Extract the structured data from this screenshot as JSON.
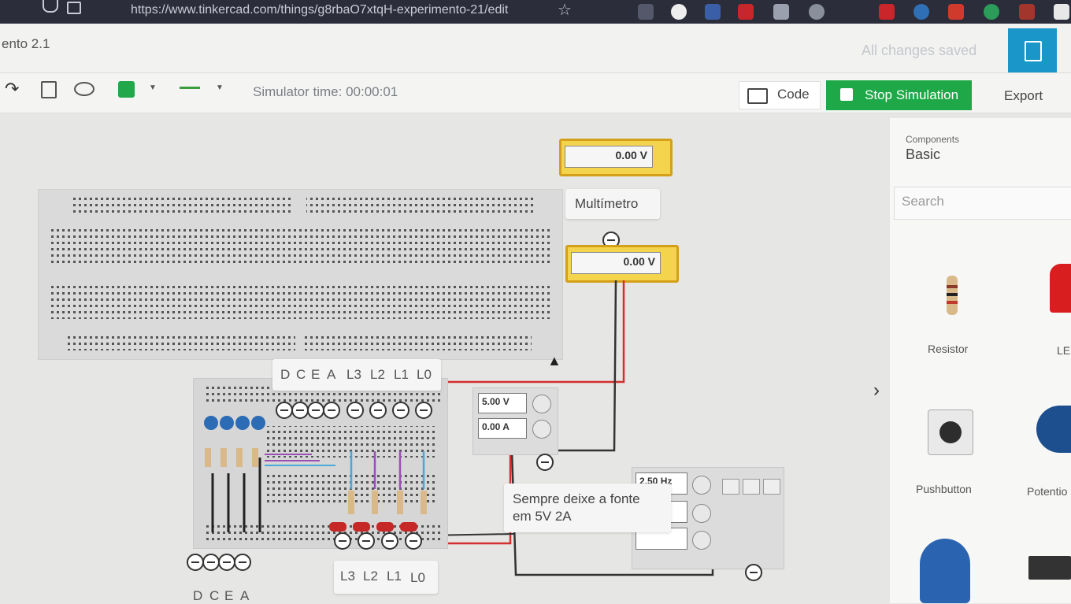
{
  "browser": {
    "url": "https://www.tinkercad.com/things/g8rbaO7xtqH-experimento-21/edit"
  },
  "header": {
    "title": "ento 2.1",
    "save_status": "All changes saved"
  },
  "toolbar": {
    "simulator_time": "Simulator time: 00:00:01",
    "code_label": "Code",
    "stop_label": "Stop Simulation",
    "export_label": "Export",
    "fill_color": "#22a84a"
  },
  "sidebar": {
    "components_label": "Components",
    "components_value": "Basic",
    "search_placeholder": "Search",
    "items": [
      {
        "label": "Resistor"
      },
      {
        "label": "LE"
      },
      {
        "label": "Pushbutton"
      },
      {
        "label": "Potentio"
      }
    ]
  },
  "canvas": {
    "multimeter_top_value": "0.00 V",
    "multimeter_label": "Multímetro",
    "multimeter_bottom_value": "0.00 V",
    "psu_voltage": "5.00 V",
    "psu_current": "0.00 A",
    "fgen_freq": "2.50 Hz",
    "note_line1": "Sempre deixe a fonte",
    "note_line2": "em 5V 2A",
    "top_labels": [
      "D",
      "C",
      "E",
      "A",
      "L3",
      "L2",
      "L1",
      "L0"
    ],
    "bottom_labels_left": [
      "D",
      "C",
      "E",
      "A"
    ],
    "bottom_labels_right": [
      "L3",
      "L2",
      "L1",
      "L0"
    ],
    "wire_red": "#d32f2f",
    "wire_black": "#333333",
    "accent_blue": "#1a96c8"
  }
}
